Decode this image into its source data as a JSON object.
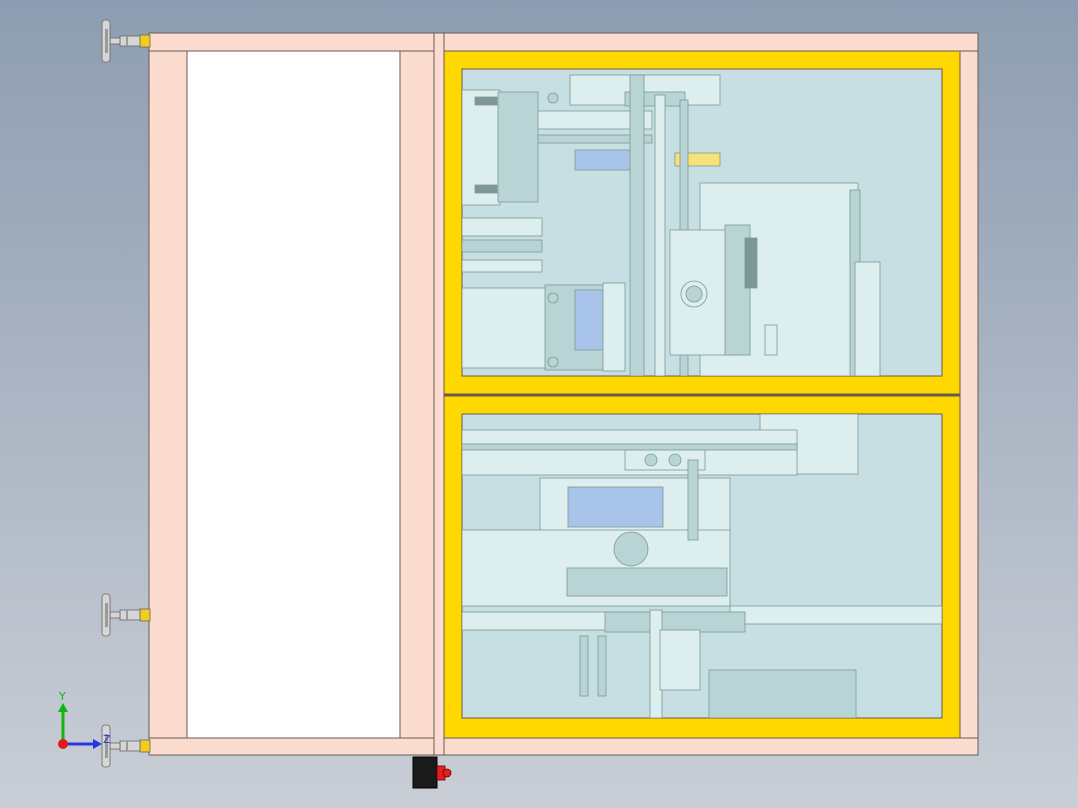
{
  "viewport": {
    "background_top": "#8e9db1",
    "background_bottom": "#c9ced6"
  },
  "colors": {
    "frame_fill": "#fbdccf",
    "frame_stroke": "#6a5a55",
    "panel_white": "#ffffff",
    "door_yellow": "#ffd800",
    "glass": "#c7dfe3",
    "machine_light": "#dcefee",
    "machine_mid": "#b9d4d4",
    "machine_dark": "#7e9696",
    "accent_yellow": "#f7e27a",
    "accent_blue": "#a9c4ea",
    "foot_grey": "#d6d6d6",
    "foot_yellow": "#f3cd1c",
    "estop_black": "#1a1a1a",
    "estop_red": "#e02020",
    "axis_y": "#11b511",
    "axis_z": "#2b35e0",
    "axis_origin": "#e01b1b"
  },
  "triad": {
    "y_label": "Y",
    "z_label": "Z"
  },
  "icons": {
    "leveling_foot": "leveling-foot-icon",
    "emergency_stop": "emergency-stop-icon",
    "axis_triad": "axis-triad-icon"
  }
}
